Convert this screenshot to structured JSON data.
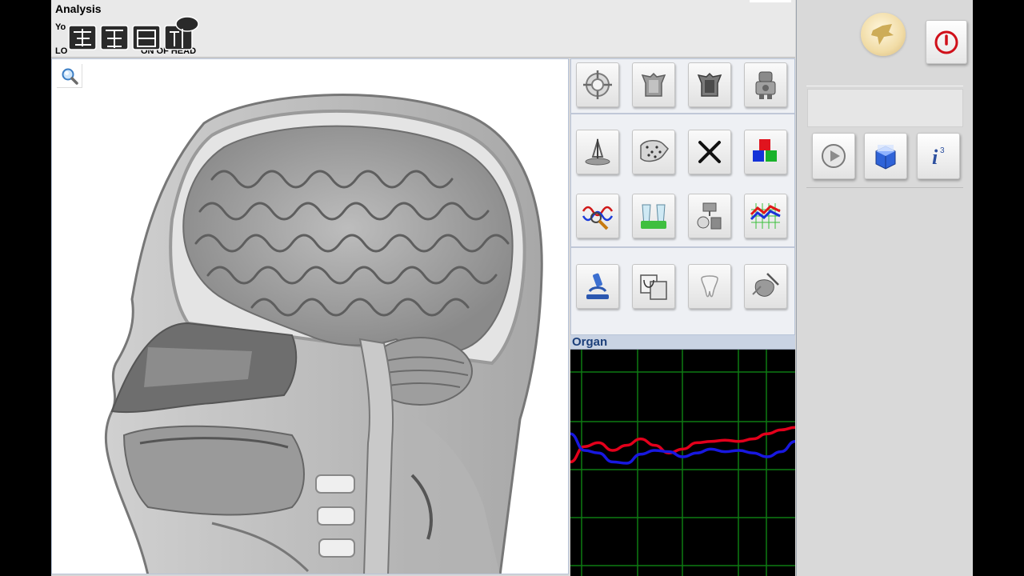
{
  "header": {
    "title": "Analysis",
    "subtitle": "Yo",
    "section": "LO                              ON OF HEAD"
  },
  "organ_panel": {
    "title": "Organ"
  },
  "toolbar_icons": [
    "crosshair-target-icon",
    "hollow-organ-icon",
    "dark-organ-icon",
    "robot-icon",
    "microscope-scan-icon",
    "dotted-organ-icon",
    "close-x-icon",
    "rgb-color-icon",
    "wave-magnifier-icon",
    "vials-icon",
    "lab-equipment-icon",
    "spectrum-graph-icon",
    "microscope-icon",
    "compare-images-icon",
    "tooth-icon",
    "organ-scalpel-icon"
  ],
  "right_panel": {
    "icons": [
      "logo-icon",
      "power-icon",
      "play-icon",
      "cube-icon",
      "info-icon"
    ]
  },
  "graph": {
    "series": [
      {
        "color": "#e3001b",
        "values": [
          -0.7,
          -0.1,
          0.05,
          -0.25,
          -0.05,
          0.2,
          -0.05,
          -0.35,
          -0.2,
          0.05,
          0.1,
          0.15,
          0.1,
          0.2,
          0.4,
          0.55,
          0.65
        ]
      },
      {
        "color": "#1818e0",
        "values": [
          0.4,
          -0.25,
          -0.35,
          -0.7,
          -0.75,
          -0.4,
          -0.25,
          -0.3,
          -0.5,
          -0.35,
          -0.2,
          -0.3,
          -0.25,
          -0.35,
          -0.5,
          -0.3,
          0.1
        ]
      }
    ],
    "colors": {
      "grid": "#0e7a12",
      "background": "#000000"
    }
  }
}
